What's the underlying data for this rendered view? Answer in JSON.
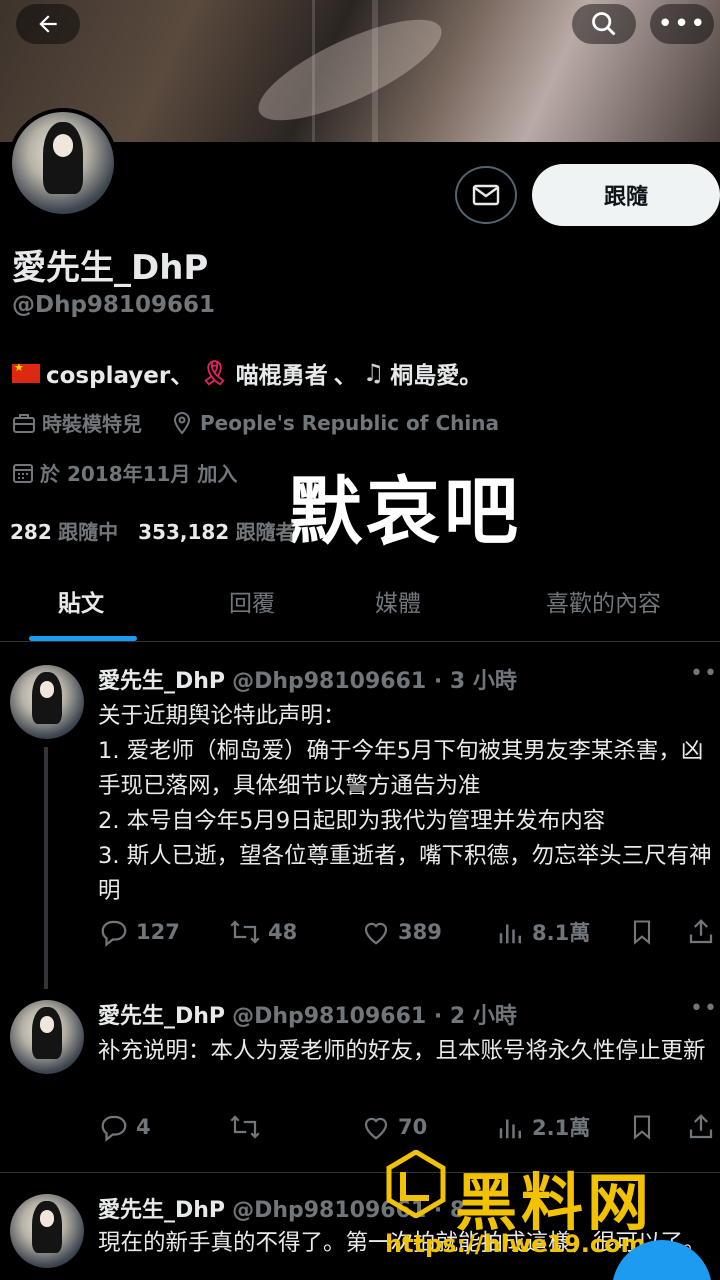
{
  "profile": {
    "display_name": "愛先生_DhP",
    "handle": "@Dhp98109661",
    "bio_parts": [
      "cosplayer、",
      "喵棍勇者",
      "、",
      "桐島愛。"
    ],
    "job": "時裝模特兒",
    "location": "People's Republic of China",
    "joined": "於 2018年11月 加入",
    "following_count": "282",
    "following_label": "跟隨中",
    "followers_count": "353,182",
    "followers_label": "跟隨者",
    "follow_button": "跟隨"
  },
  "overlay_caption": "默哀吧",
  "tabs": [
    "貼文",
    "回覆",
    "媒體",
    "喜歡的內容"
  ],
  "tweets": [
    {
      "name": "愛先生_DhP",
      "handle_time": "@Dhp98109661 · 3 小時",
      "body": "关于近期舆论特此声明：\n1. 爱老师（桐岛爱）确于今年5月下旬被其男友李某杀害，凶手现已落网，具体细节以警方通告为准\n2. 本号自今年5月9日起即为我代为管理并发布内容\n3. 斯人已逝，望各位尊重逝者，嘴下积德，勿忘举头三尺有神明",
      "replies": "127",
      "retweets": "48",
      "likes": "389",
      "views": "8.1萬"
    },
    {
      "name": "愛先生_DhP",
      "handle_time": "@Dhp98109661 · 2 小時",
      "body": "补充说明：本人为爱老师的好友，且本账号将永久性停止更新",
      "replies": "4",
      "retweets": "",
      "likes": "70",
      "views": "2.1萬"
    },
    {
      "name": "愛先生_DhP",
      "handle_time": "@Dhp98109661 · 8",
      "body": "現在的新手真的不得了。第一次拍就能拍成這樣，很可以了。"
    }
  ],
  "watermark": {
    "title": "黑料网",
    "url": "https://hlwe19.com"
  },
  "colors": {
    "accent": "#1d9bf0",
    "muted": "#71767b",
    "watermark": "#f2c200"
  }
}
